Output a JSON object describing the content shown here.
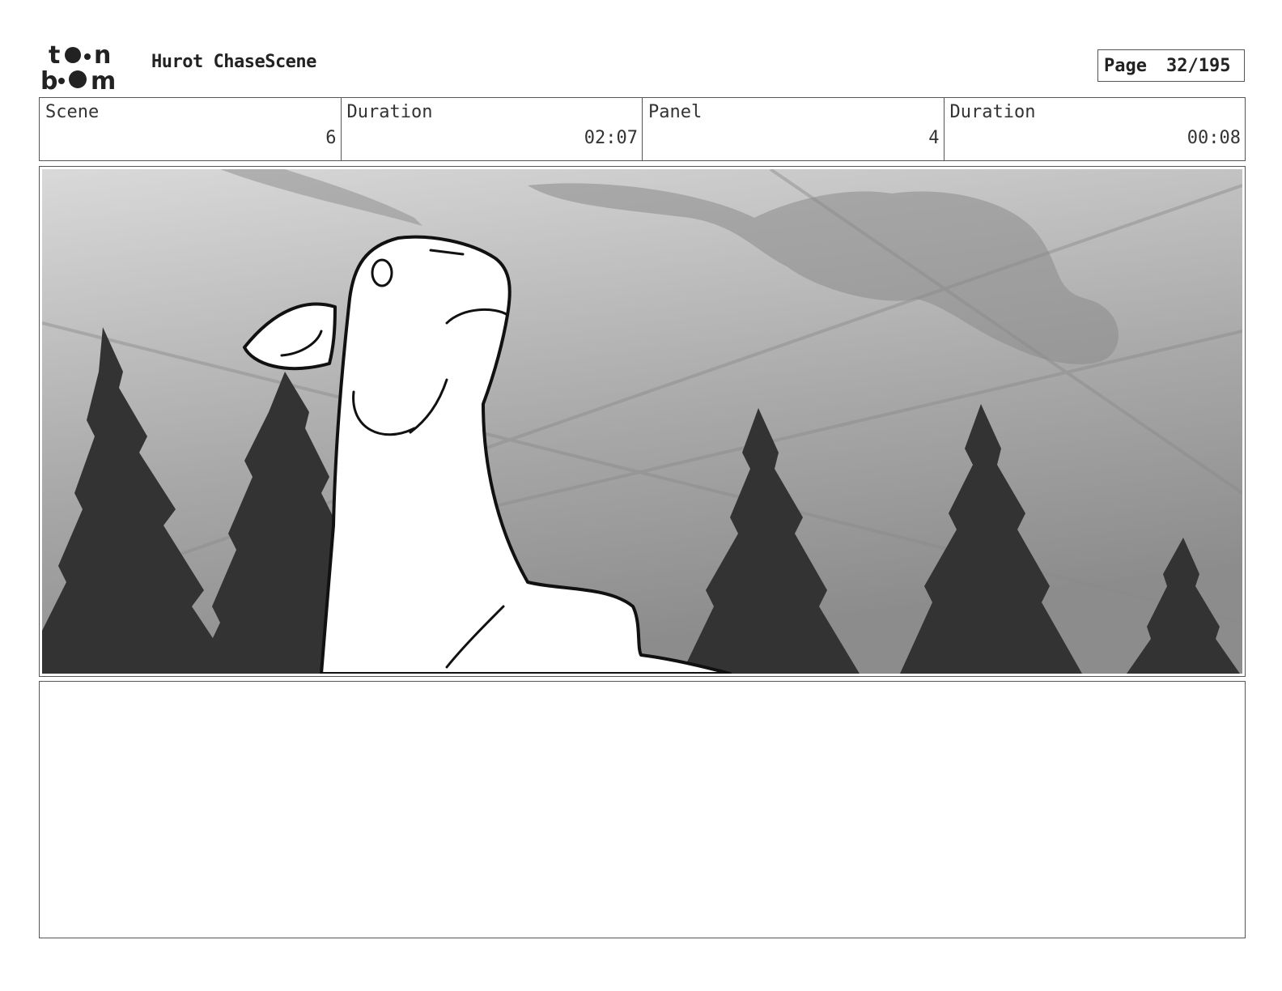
{
  "header": {
    "logo_text": "toon boom",
    "title": "Hurot ChaseScene",
    "page_label": "Page",
    "page_value": "32/195"
  },
  "info": {
    "scene_label": "Scene",
    "scene_value": "6",
    "scene_duration_label": "Duration",
    "scene_duration_value": "02:07",
    "panel_label": "Panel",
    "panel_value": "4",
    "panel_duration_label": "Duration",
    "panel_duration_value": "00:08"
  },
  "notes": {
    "text": ""
  }
}
